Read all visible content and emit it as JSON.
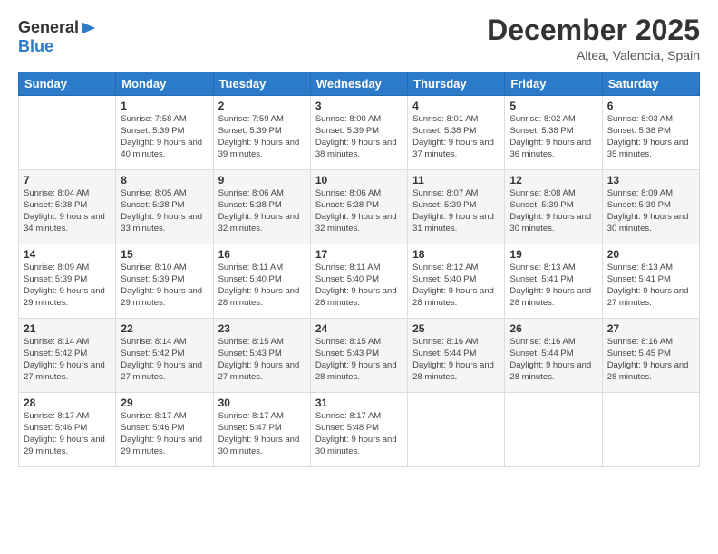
{
  "header": {
    "logo_general": "General",
    "logo_blue": "Blue",
    "month_title": "December 2025",
    "location": "Altea, Valencia, Spain"
  },
  "weekdays": [
    "Sunday",
    "Monday",
    "Tuesday",
    "Wednesday",
    "Thursday",
    "Friday",
    "Saturday"
  ],
  "weeks": [
    [
      {
        "day": "",
        "sunrise": "",
        "sunset": "",
        "daylight": ""
      },
      {
        "day": "1",
        "sunrise": "Sunrise: 7:58 AM",
        "sunset": "Sunset: 5:39 PM",
        "daylight": "Daylight: 9 hours and 40 minutes."
      },
      {
        "day": "2",
        "sunrise": "Sunrise: 7:59 AM",
        "sunset": "Sunset: 5:39 PM",
        "daylight": "Daylight: 9 hours and 39 minutes."
      },
      {
        "day": "3",
        "sunrise": "Sunrise: 8:00 AM",
        "sunset": "Sunset: 5:39 PM",
        "daylight": "Daylight: 9 hours and 38 minutes."
      },
      {
        "day": "4",
        "sunrise": "Sunrise: 8:01 AM",
        "sunset": "Sunset: 5:38 PM",
        "daylight": "Daylight: 9 hours and 37 minutes."
      },
      {
        "day": "5",
        "sunrise": "Sunrise: 8:02 AM",
        "sunset": "Sunset: 5:38 PM",
        "daylight": "Daylight: 9 hours and 36 minutes."
      },
      {
        "day": "6",
        "sunrise": "Sunrise: 8:03 AM",
        "sunset": "Sunset: 5:38 PM",
        "daylight": "Daylight: 9 hours and 35 minutes."
      }
    ],
    [
      {
        "day": "7",
        "sunrise": "Sunrise: 8:04 AM",
        "sunset": "Sunset: 5:38 PM",
        "daylight": "Daylight: 9 hours and 34 minutes."
      },
      {
        "day": "8",
        "sunrise": "Sunrise: 8:05 AM",
        "sunset": "Sunset: 5:38 PM",
        "daylight": "Daylight: 9 hours and 33 minutes."
      },
      {
        "day": "9",
        "sunrise": "Sunrise: 8:06 AM",
        "sunset": "Sunset: 5:38 PM",
        "daylight": "Daylight: 9 hours and 32 minutes."
      },
      {
        "day": "10",
        "sunrise": "Sunrise: 8:06 AM",
        "sunset": "Sunset: 5:38 PM",
        "daylight": "Daylight: 9 hours and 32 minutes."
      },
      {
        "day": "11",
        "sunrise": "Sunrise: 8:07 AM",
        "sunset": "Sunset: 5:39 PM",
        "daylight": "Daylight: 9 hours and 31 minutes."
      },
      {
        "day": "12",
        "sunrise": "Sunrise: 8:08 AM",
        "sunset": "Sunset: 5:39 PM",
        "daylight": "Daylight: 9 hours and 30 minutes."
      },
      {
        "day": "13",
        "sunrise": "Sunrise: 8:09 AM",
        "sunset": "Sunset: 5:39 PM",
        "daylight": "Daylight: 9 hours and 30 minutes."
      }
    ],
    [
      {
        "day": "14",
        "sunrise": "Sunrise: 8:09 AM",
        "sunset": "Sunset: 5:39 PM",
        "daylight": "Daylight: 9 hours and 29 minutes."
      },
      {
        "day": "15",
        "sunrise": "Sunrise: 8:10 AM",
        "sunset": "Sunset: 5:39 PM",
        "daylight": "Daylight: 9 hours and 29 minutes."
      },
      {
        "day": "16",
        "sunrise": "Sunrise: 8:11 AM",
        "sunset": "Sunset: 5:40 PM",
        "daylight": "Daylight: 9 hours and 28 minutes."
      },
      {
        "day": "17",
        "sunrise": "Sunrise: 8:11 AM",
        "sunset": "Sunset: 5:40 PM",
        "daylight": "Daylight: 9 hours and 28 minutes."
      },
      {
        "day": "18",
        "sunrise": "Sunrise: 8:12 AM",
        "sunset": "Sunset: 5:40 PM",
        "daylight": "Daylight: 9 hours and 28 minutes."
      },
      {
        "day": "19",
        "sunrise": "Sunrise: 8:13 AM",
        "sunset": "Sunset: 5:41 PM",
        "daylight": "Daylight: 9 hours and 28 minutes."
      },
      {
        "day": "20",
        "sunrise": "Sunrise: 8:13 AM",
        "sunset": "Sunset: 5:41 PM",
        "daylight": "Daylight: 9 hours and 27 minutes."
      }
    ],
    [
      {
        "day": "21",
        "sunrise": "Sunrise: 8:14 AM",
        "sunset": "Sunset: 5:42 PM",
        "daylight": "Daylight: 9 hours and 27 minutes."
      },
      {
        "day": "22",
        "sunrise": "Sunrise: 8:14 AM",
        "sunset": "Sunset: 5:42 PM",
        "daylight": "Daylight: 9 hours and 27 minutes."
      },
      {
        "day": "23",
        "sunrise": "Sunrise: 8:15 AM",
        "sunset": "Sunset: 5:43 PM",
        "daylight": "Daylight: 9 hours and 27 minutes."
      },
      {
        "day": "24",
        "sunrise": "Sunrise: 8:15 AM",
        "sunset": "Sunset: 5:43 PM",
        "daylight": "Daylight: 9 hours and 28 minutes."
      },
      {
        "day": "25",
        "sunrise": "Sunrise: 8:16 AM",
        "sunset": "Sunset: 5:44 PM",
        "daylight": "Daylight: 9 hours and 28 minutes."
      },
      {
        "day": "26",
        "sunrise": "Sunrise: 8:16 AM",
        "sunset": "Sunset: 5:44 PM",
        "daylight": "Daylight: 9 hours and 28 minutes."
      },
      {
        "day": "27",
        "sunrise": "Sunrise: 8:16 AM",
        "sunset": "Sunset: 5:45 PM",
        "daylight": "Daylight: 9 hours and 28 minutes."
      }
    ],
    [
      {
        "day": "28",
        "sunrise": "Sunrise: 8:17 AM",
        "sunset": "Sunset: 5:46 PM",
        "daylight": "Daylight: 9 hours and 29 minutes."
      },
      {
        "day": "29",
        "sunrise": "Sunrise: 8:17 AM",
        "sunset": "Sunset: 5:46 PM",
        "daylight": "Daylight: 9 hours and 29 minutes."
      },
      {
        "day": "30",
        "sunrise": "Sunrise: 8:17 AM",
        "sunset": "Sunset: 5:47 PM",
        "daylight": "Daylight: 9 hours and 30 minutes."
      },
      {
        "day": "31",
        "sunrise": "Sunrise: 8:17 AM",
        "sunset": "Sunset: 5:48 PM",
        "daylight": "Daylight: 9 hours and 30 minutes."
      },
      {
        "day": "",
        "sunrise": "",
        "sunset": "",
        "daylight": ""
      },
      {
        "day": "",
        "sunrise": "",
        "sunset": "",
        "daylight": ""
      },
      {
        "day": "",
        "sunrise": "",
        "sunset": "",
        "daylight": ""
      }
    ]
  ]
}
